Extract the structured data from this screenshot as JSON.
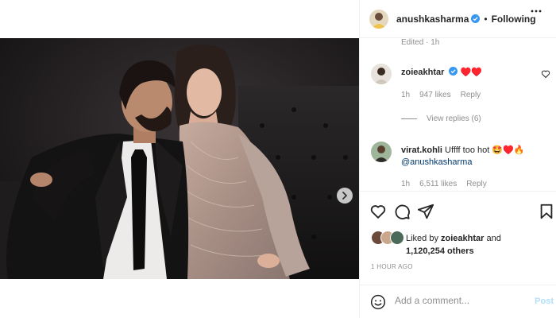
{
  "post": {
    "author": "anushkasharma",
    "follow_status": "Following",
    "separator": "•",
    "more_icon": "more-horizontal-icon",
    "edited": "Edited · 1h",
    "carousel": {
      "slides": 3,
      "active": 0
    }
  },
  "comments": [
    {
      "user": "zoieakhtar",
      "verified": true,
      "text": "♥️♥️",
      "age": "1h",
      "likes": "947 likes",
      "reply": "Reply",
      "view_replies": "View replies (6)"
    },
    {
      "user": "virat.kohli",
      "verified": false,
      "text": "Uffff too hot 🤩♥️🔥",
      "mention": "@anushkasharma",
      "age": "1h",
      "likes": "6,511 likes",
      "reply": "Reply"
    }
  ],
  "likes": {
    "prefix": "Liked by ",
    "first_user": "zoieakhtar",
    "middle": " and",
    "count": "1,120,254 others"
  },
  "timestamp": "1 HOUR AGO",
  "composer": {
    "placeholder": "Add a comment...",
    "post_label": "Post"
  },
  "colors": {
    "verified": "#3897f0",
    "heart": "#ed4956",
    "post_disabled": "#b2dffc",
    "muted": "#8e8e8e"
  }
}
